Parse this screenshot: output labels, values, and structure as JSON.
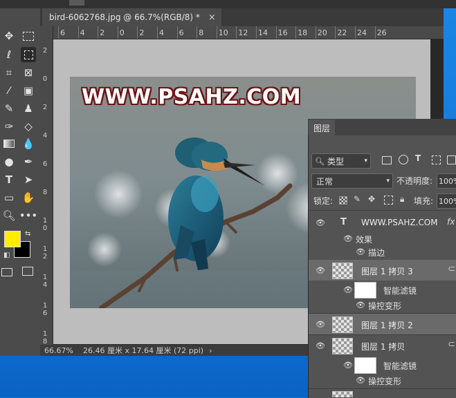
{
  "document": {
    "tab_title": "bird-6062768.jpg @ 66.7%(RGB/8) *",
    "close_glyph": "×",
    "watermark_text": "WWW.PSAHZ.COM"
  },
  "ruler": {
    "top_labels": [
      "6",
      "4",
      "2",
      "0",
      "2",
      "4",
      "6",
      "8",
      "10",
      "12",
      "14",
      "16",
      "18",
      "20",
      "22",
      "24",
      "26"
    ],
    "left_labels": [
      "2",
      "0",
      "2",
      "4",
      "6",
      "8",
      "10",
      "12",
      "14",
      "16",
      "18"
    ]
  },
  "status": {
    "zoom": "66.67%",
    "info": "26.46 厘米 x 17.64 厘米 (72 ppi)",
    "arrow": "›"
  },
  "colors": {
    "foreground": "#ffee00",
    "background": "#000000",
    "watermark_fill": "#ffffff",
    "watermark_stroke": "#6a1414"
  },
  "tools": [
    "move-icon",
    "marquee-icon",
    "lasso-icon",
    "object-select-icon",
    "crop-icon",
    "frame-icon",
    "eyedropper-icon",
    "patch-icon",
    "brush-icon",
    "stamp-icon",
    "history-brush-icon",
    "eraser-icon",
    "gradient-icon",
    "blur-icon",
    "dodge-icon",
    "pen-icon",
    "type-icon",
    "path-select-icon",
    "rectangle-icon",
    "hand-icon",
    "zoom-icon",
    "more-icon"
  ],
  "layers_panel": {
    "tab": "图层",
    "filter_label": "类型",
    "blend_mode": "正常",
    "opacity_label": "不透明度:",
    "opacity_value": "100%",
    "lock_label": "锁定:",
    "fill_label": "填充:",
    "fill_value": "100%",
    "layers": [
      {
        "name": "WWW.PSAHZ.COM",
        "type": "text",
        "fx": "fx"
      },
      {
        "name": "效果",
        "type": "effects-label"
      },
      {
        "name": "描边",
        "type": "effect"
      },
      {
        "name": "图层 1 拷贝 3",
        "type": "smart"
      },
      {
        "name": "智能滤镜",
        "type": "filter"
      },
      {
        "name": "操控变形",
        "type": "filter-item"
      },
      {
        "name": "图层 1 拷贝 2",
        "type": "smart"
      },
      {
        "name": "图层 1 拷贝",
        "type": "smart"
      },
      {
        "name": "智能滤镜",
        "type": "filter"
      },
      {
        "name": "操控变形",
        "type": "filter-item"
      }
    ]
  }
}
